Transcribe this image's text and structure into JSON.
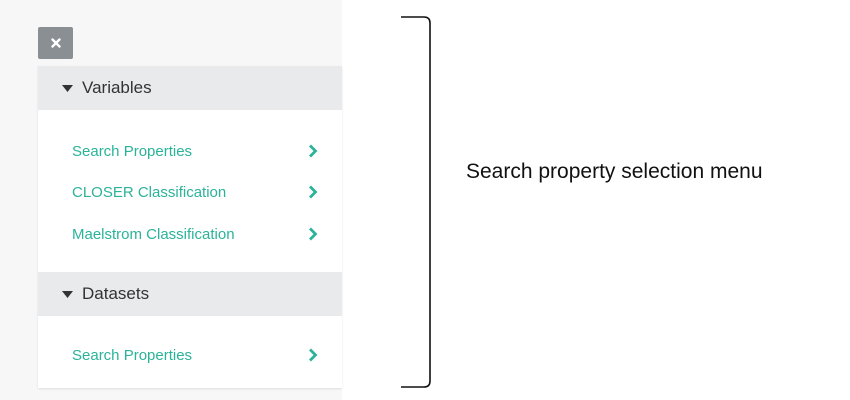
{
  "close_button": {
    "icon": "close-icon"
  },
  "sections": [
    {
      "title": "Variables",
      "expanded": true,
      "items": [
        {
          "label": "Search Properties"
        },
        {
          "label": "CLOSER Classification"
        },
        {
          "label": "Maelstrom Classification"
        }
      ]
    },
    {
      "title": "Datasets",
      "expanded": true,
      "items": [
        {
          "label": "Search Properties"
        }
      ]
    }
  ],
  "annotation": {
    "text": "Search property selection menu"
  },
  "colors": {
    "accent": "#2bb39a",
    "header_bg": "#e9eaeb",
    "close_bg": "#8a8f93"
  }
}
